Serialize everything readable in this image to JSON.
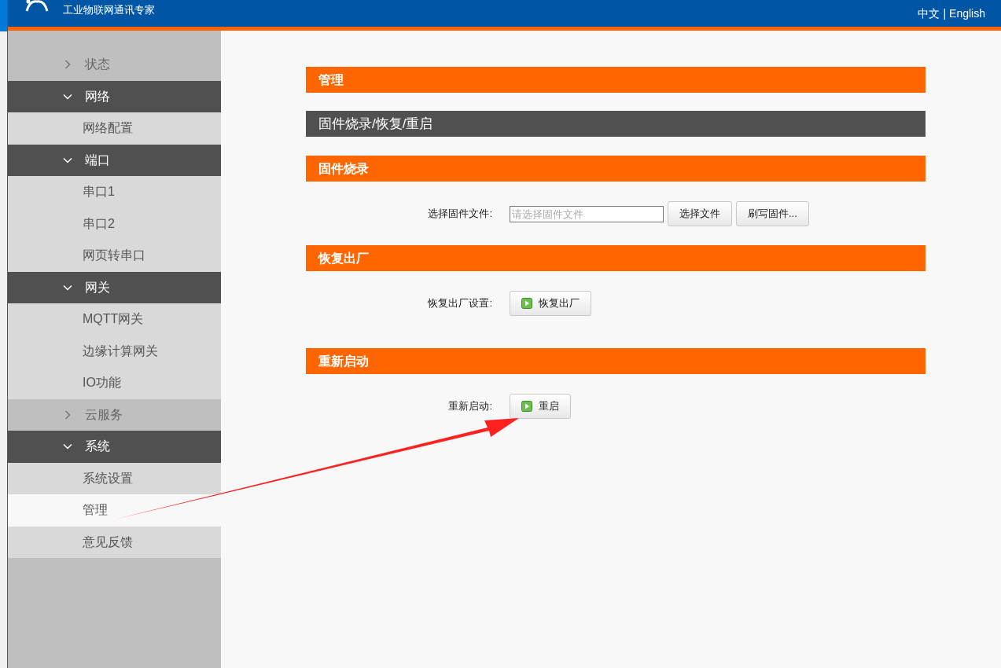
{
  "header": {
    "tagline": "工业物联网通讯专家",
    "languages": [
      "中文",
      "English"
    ],
    "separator": "|"
  },
  "sidebar": {
    "groups": [
      {
        "label": "状态",
        "expanded": false
      },
      {
        "label": "网络",
        "expanded": true,
        "children": [
          {
            "label": "网络配置",
            "selected": false
          }
        ]
      },
      {
        "label": "端口",
        "expanded": true,
        "children": [
          {
            "label": "串口1",
            "selected": false
          },
          {
            "label": "串口2",
            "selected": false
          },
          {
            "label": "网页转串口",
            "selected": false
          }
        ]
      },
      {
        "label": "网关",
        "expanded": true,
        "children": [
          {
            "label": "MQTT网关",
            "selected": false
          },
          {
            "label": "边缘计算网关",
            "selected": false
          },
          {
            "label": "IO功能",
            "selected": false
          }
        ]
      },
      {
        "label": "云服务",
        "expanded": false
      },
      {
        "label": "系统",
        "expanded": true,
        "children": [
          {
            "label": "系统设置",
            "selected": false
          },
          {
            "label": "管理",
            "selected": true
          },
          {
            "label": "意见反馈",
            "selected": false
          }
        ]
      }
    ]
  },
  "main": {
    "page_title": "管理",
    "section_title": "固件烧录/恢复/重启",
    "sections": [
      {
        "title": "固件烧录",
        "row": {
          "kind": "file",
          "label": "选择固件文件:",
          "field": {
            "placeholder": "请选择固件文件"
          },
          "buttons": [
            "选择文件",
            "刷写固件..."
          ]
        }
      },
      {
        "title": "恢复出厂",
        "row": {
          "kind": "action",
          "label": "恢复出厂设置:",
          "button": "恢复出厂"
        }
      },
      {
        "title": "重新启动",
        "row": {
          "kind": "action",
          "label": "重新启动:",
          "button": "重启"
        }
      }
    ]
  }
}
